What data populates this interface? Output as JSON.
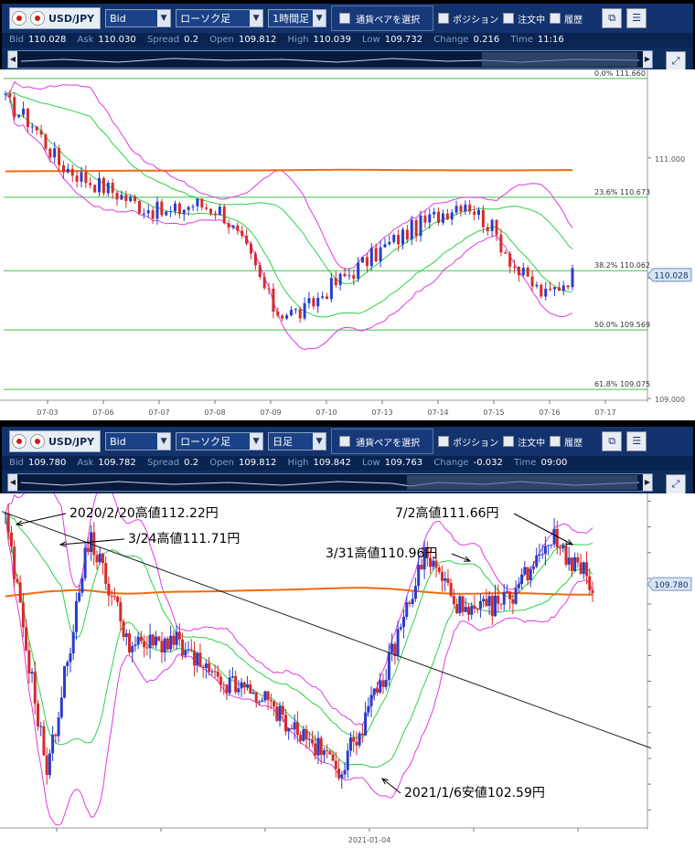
{
  "top": {
    "toolbar": {
      "symbol": "USD/JPY",
      "price_type": "Bid",
      "chart_type": "ローソク足",
      "period": "1時間足",
      "pair_button": "通貨ペアを選択",
      "toggles": [
        "ポジション",
        "注文中",
        "履歴"
      ]
    },
    "info": {
      "bid": "110.028",
      "ask": "110.030",
      "spread": "0.2",
      "open": "109.812",
      "high": "110.039",
      "low": "109.732",
      "change": "0.216",
      "time": "11:16"
    },
    "info_labels": {
      "bid": "Bid",
      "ask": "Ask",
      "spread": "Spread",
      "open": "Open",
      "high": "High",
      "low": "Low",
      "change": "Change",
      "time": "Time"
    },
    "current_price": "110.028",
    "y_ticks": [
      "111.000",
      "110.000",
      "109.000"
    ],
    "fib": [
      {
        "label": "0.0%",
        "value": "111.660"
      },
      {
        "label": "23.6%",
        "value": "110.673"
      },
      {
        "label": "38.2%",
        "value": "110.062"
      },
      {
        "label": "50.0%",
        "value": "109.569"
      },
      {
        "label": "61.8%",
        "value": "109.075"
      }
    ],
    "x_ticks": [
      "07-03",
      "07-06",
      "07-07",
      "07-08",
      "07-09",
      "07-10",
      "07-13",
      "07-14",
      "07-15",
      "07-16",
      "07-17"
    ]
  },
  "bottom": {
    "toolbar": {
      "symbol": "USD/JPY",
      "price_type": "Bid",
      "chart_type": "ローソク足",
      "period": "日足",
      "pair_button": "通貨ペアを選択",
      "toggles": [
        "ポジション",
        "注文中",
        "履歴"
      ]
    },
    "info": {
      "bid": "109.780",
      "ask": "109.782",
      "spread": "0.2",
      "open": "109.812",
      "high": "109.842",
      "low": "109.763",
      "change": "-0.032",
      "time": "09:00"
    },
    "info_labels": {
      "bid": "Bid",
      "ask": "Ask",
      "spread": "Spread",
      "open": "Open",
      "high": "High",
      "low": "Low",
      "change": "Change",
      "time": "Time"
    },
    "current_price": "109.780",
    "x_ticks": [
      "2021-01-04"
    ],
    "annotations": [
      "2020/2/20高値112.22円",
      "3/24高値111.71円",
      "3/31高値110.96円",
      "7/2高値111.66円",
      "2021/1/6安値102.59円"
    ]
  },
  "colors": {
    "up": "#2b3cc8",
    "down": "#d42b2b",
    "ma": "#f06a10",
    "bb_inner": "#2fd04a",
    "bb_outer": "#e03ae0",
    "fib": "#3ec24a",
    "trend": "#222222"
  },
  "chart_data": [
    {
      "type": "candlestick",
      "title": "USD/JPY 1時間足",
      "x": [
        "07-03",
        "07-06",
        "07-07",
        "07-08",
        "07-09",
        "07-10",
        "07-13",
        "07-14",
        "07-15",
        "07-16",
        "07-17"
      ],
      "ylim": [
        108.985,
        111.72
      ],
      "close_path": [
        [
          "07-02",
          111.47
        ],
        [
          "07-03",
          111.28
        ],
        [
          "07-03",
          110.95
        ],
        [
          "07-06",
          110.82
        ],
        [
          "07-06",
          110.72
        ],
        [
          "07-07",
          110.6
        ],
        [
          "07-07",
          110.53
        ],
        [
          "07-08",
          110.62
        ],
        [
          "07-08",
          110.56
        ],
        [
          "07-08",
          110.2
        ],
        [
          "07-09",
          109.72
        ],
        [
          "07-09",
          109.71
        ],
        [
          "07-10",
          109.92
        ],
        [
          "07-10",
          110.08
        ],
        [
          "07-13",
          110.25
        ],
        [
          "07-13",
          110.4
        ],
        [
          "07-14",
          110.52
        ],
        [
          "07-14",
          110.65
        ],
        [
          "07-15",
          110.42
        ],
        [
          "07-15",
          110.05
        ],
        [
          "07-16",
          109.85
        ],
        [
          "07-16",
          110.03
        ]
      ],
      "fibonacci": [
        {
          "level": "0.0%",
          "price": 111.66
        },
        {
          "level": "23.6%",
          "price": 110.673
        },
        {
          "level": "38.2%",
          "price": 110.062
        },
        {
          "level": "50.0%",
          "price": 109.569
        },
        {
          "level": "61.8%",
          "price": 109.075
        }
      ],
      "indicators": [
        "moving average",
        "Bollinger Bands ±1σ",
        "Bollinger Bands ±2σ"
      ],
      "last": 110.028
    },
    {
      "type": "candlestick",
      "title": "USD/JPY 日足",
      "x": [
        "2021-01-04"
      ],
      "close_path": [
        [
          "2020-02-20",
          112.22
        ],
        [
          "2020-03-09",
          102.4
        ],
        [
          "2020-03-24",
          111.71
        ],
        [
          "2020-05",
          107.3
        ],
        [
          "2020-06",
          107.6
        ],
        [
          "2020-08",
          106.0
        ],
        [
          "2020-10",
          105.5
        ],
        [
          "2020-11",
          104.0
        ],
        [
          "2021-01-06",
          102.59
        ],
        [
          "2021-02",
          106.0
        ],
        [
          "2021-03-31",
          110.96
        ],
        [
          "2021-04",
          108.5
        ],
        [
          "2021-05",
          109.2
        ],
        [
          "2021-07-02",
          111.66
        ],
        [
          "2021-07",
          109.78
        ]
      ],
      "annotations": [
        {
          "text": "2020/2/20高値112.22円",
          "price": 112.22
        },
        {
          "text": "3/24高値111.71円",
          "price": 111.71
        },
        {
          "text": "3/31高値110.96円",
          "price": 110.96
        },
        {
          "text": "7/2高値111.66円",
          "price": 111.66
        },
        {
          "text": "2021/1/6安値102.59円",
          "price": 102.59
        }
      ],
      "trendline": "from 2020/2/20 high through 3/24 high, descending",
      "indicators": [
        "moving average",
        "Bollinger Bands ±1σ",
        "Bollinger Bands ±2σ"
      ],
      "last": 109.78
    }
  ]
}
